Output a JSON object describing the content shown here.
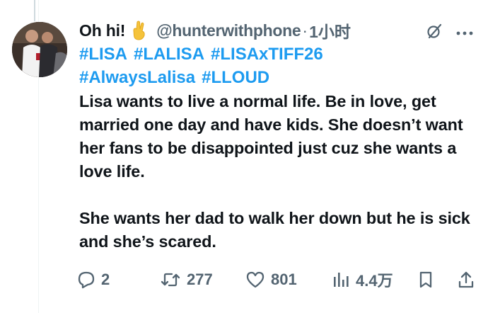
{
  "tweet": {
    "display_name": "Oh hi!",
    "emoji": "crossed-fingers",
    "handle": "@hunterwithphone",
    "separator": "·",
    "time": "1小时",
    "hashtags": [
      "#LISA",
      "#LALISA",
      "#LISAxTIFF26",
      "#AlwaysLalisa",
      "#LLOUD"
    ],
    "body_para1": "Lisa wants to live a normal life. Be in love, get married one day and have kids. She doesn’t want her fans to be disappointed just cuz she wants a love life.",
    "body_para2": "She wants her dad to walk her down but he is sick and she’s scared."
  },
  "actions": {
    "reply_count": "2",
    "retweet_count": "277",
    "like_count": "801",
    "views_count": "4.4万"
  },
  "colors": {
    "hashtag": "#1d9bf0",
    "secondary": "#536471",
    "text": "#0f1419"
  }
}
